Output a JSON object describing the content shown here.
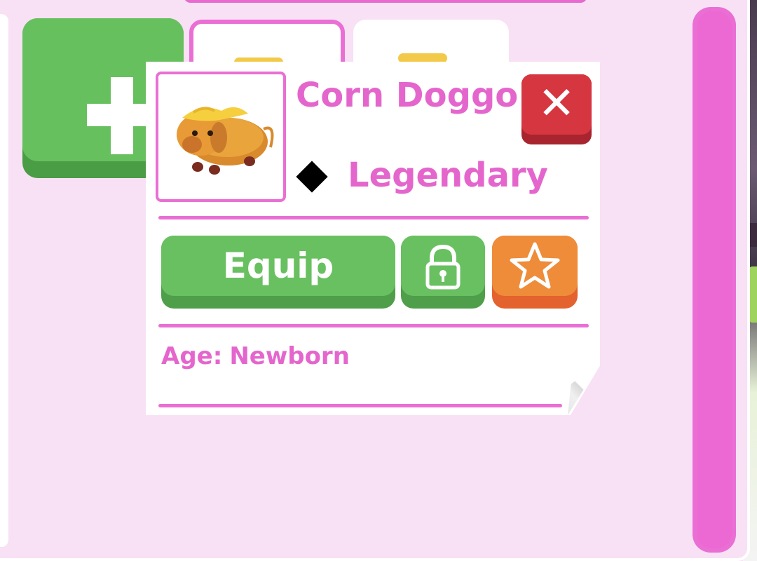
{
  "pet": {
    "name": "Corn Doggo",
    "rarity": "Legendary",
    "age_label": "Age:",
    "age_value": "Newborn",
    "image_icon": "corn-doggo-pet-image"
  },
  "actions": {
    "equip_label": "Equip",
    "close_label": "✕",
    "lock_icon": "lock-icon",
    "favorite_icon": "star-icon",
    "add_icon": "plus-icon"
  },
  "colors": {
    "panel_background": "#f8e0f5",
    "accent_pink": "#e466cd",
    "button_green": "#69c060",
    "button_red": "#d6363f",
    "button_orange": "#ee8c3a",
    "rarity_diamond": "#000000"
  }
}
